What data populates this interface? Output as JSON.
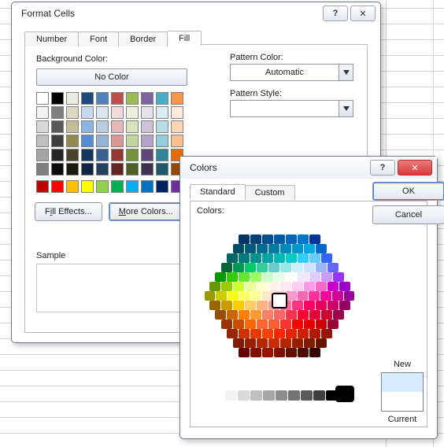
{
  "format_dialog": {
    "title": "Format Cells",
    "tabs": [
      "Number",
      "Font",
      "Border",
      "Fill"
    ],
    "active_tab": "Fill",
    "bg_label": "Background Color:",
    "no_color_label": "No Color",
    "fill_effects_label": "Fill Effects...",
    "more_colors_label": "More Colors...",
    "pattern_color_label": "Pattern Color:",
    "pattern_color_value": "Automatic",
    "pattern_style_label": "Pattern Style:",
    "sample_label": "Sample",
    "palette_rows": [
      [
        "#ffffff",
        "#000000",
        "#eeece1",
        "#1f497d",
        "#4f81bd",
        "#c0504d",
        "#9bbb59",
        "#8064a2",
        "#4bacc6",
        "#f79646"
      ],
      [
        "#f2f2f2",
        "#7f7f7f",
        "#ddd9c3",
        "#c6d9f0",
        "#dbe5f1",
        "#f2dcdb",
        "#ebf1dd",
        "#e5e0ec",
        "#dbeef3",
        "#fdeada"
      ],
      [
        "#d8d8d8",
        "#595959",
        "#c4bd97",
        "#8db3e2",
        "#b8cce4",
        "#e5b9b7",
        "#d7e3bc",
        "#ccc1d9",
        "#b7dde8",
        "#fbd5b5"
      ],
      [
        "#bfbfbf",
        "#3f3f3f",
        "#938953",
        "#548dd4",
        "#95b3d7",
        "#d99694",
        "#c3d69b",
        "#b2a2c7",
        "#92cddc",
        "#fac08f"
      ],
      [
        "#a5a5a5",
        "#262626",
        "#494429",
        "#17365d",
        "#366092",
        "#953734",
        "#76923c",
        "#5f497a",
        "#31859b",
        "#e36c09"
      ],
      [
        "#7f7f7f",
        "#0c0c0c",
        "#1d1b10",
        "#0f243e",
        "#244061",
        "#632423",
        "#4f6128",
        "#3f3151",
        "#205867",
        "#974806"
      ]
    ],
    "standard_row": [
      "#c00000",
      "#ff0000",
      "#ffc000",
      "#ffff00",
      "#92d050",
      "#00b050",
      "#00b0f0",
      "#0070c0",
      "#002060",
      "#7030a0"
    ]
  },
  "colors_dialog": {
    "title": "Colors",
    "tabs": [
      "Standard",
      "Custom"
    ],
    "active_tab": "Standard",
    "colors_label": "Colors:",
    "ok_label": "OK",
    "cancel_label": "Cancel",
    "new_label": "New",
    "current_label": "Current",
    "new_color": "#d7ecff",
    "current_color": "#ffffff",
    "hex_rows": [
      [
        "#003366",
        "#00407a",
        "#004d8f",
        "#0059a3",
        "#0066b8",
        "#0073cc",
        "#003399"
      ],
      [
        "#004d66",
        "#005c7a",
        "#006b8f",
        "#007aa3",
        "#0089b8",
        "#0099cc",
        "#00a8e0",
        "#0066cc"
      ],
      [
        "#006666",
        "#007a7a",
        "#008f8f",
        "#00a3a3",
        "#00b8b8",
        "#00cccc",
        "#33ccff",
        "#66ccff",
        "#3366ff"
      ],
      [
        "#006633",
        "#00994d",
        "#00cc66",
        "#33cc99",
        "#66cccc",
        "#99e6e6",
        "#cceeff",
        "#cce0ff",
        "#99b3ff",
        "#6666ff"
      ],
      [
        "#009900",
        "#33cc00",
        "#66e633",
        "#99ff66",
        "#ccffcc",
        "#e6ffe6",
        "#ffffff",
        "#f0e6ff",
        "#e0ccff",
        "#cc99ff",
        "#9933ff"
      ],
      [
        "#669900",
        "#99cc00",
        "#ccff33",
        "#e6ff99",
        "#ffffcc",
        "#fff2e6",
        "#ffe6f0",
        "#ffccf2",
        "#ff99e6",
        "#ff66cc",
        "#cc00cc",
        "#9900cc"
      ],
      [
        "#999900",
        "#cccc00",
        "#ffff00",
        "#ffff66",
        "#ffff99",
        "#ffe6cc",
        "#ffcccc",
        "#ff99cc",
        "#ff66b3",
        "#ff3399",
        "#ff0099",
        "#cc0099",
        "#990099"
      ],
      [
        "#996600",
        "#cc9900",
        "#ffcc00",
        "#ffcc66",
        "#ffb380",
        "#ff9999",
        "#ff6699",
        "#ff3380",
        "#ff0066",
        "#e6005c",
        "#cc0066",
        "#990066"
      ],
      [
        "#994d00",
        "#cc6600",
        "#ff8000",
        "#ff9933",
        "#ff8066",
        "#ff6666",
        "#ff334d",
        "#ff0033",
        "#e60039",
        "#cc0033",
        "#99004d"
      ],
      [
        "#993300",
        "#cc4d00",
        "#ff6600",
        "#ff6633",
        "#ff5c33",
        "#ff3333",
        "#ff0000",
        "#e60000",
        "#cc0000",
        "#990033"
      ],
      [
        "#992600",
        "#cc3300",
        "#e63900",
        "#ff4000",
        "#ff2600",
        "#e62200",
        "#cc1f00",
        "#b31900",
        "#991400"
      ],
      [
        "#801a00",
        "#992000",
        "#b32600",
        "#cc2b00",
        "#b32400",
        "#991f00",
        "#801a00",
        "#661400"
      ],
      [
        "#660000",
        "#800d00",
        "#991200",
        "#801000",
        "#660d00",
        "#4d0a00",
        "#330700"
      ]
    ],
    "gray_scale": [
      "#ffffff",
      "#f2f2f2",
      "#d9d9d9",
      "#bfbfbf",
      "#a6a6a6",
      "#8c8c8c",
      "#737373",
      "#595959",
      "#404040",
      "#000000"
    ]
  }
}
